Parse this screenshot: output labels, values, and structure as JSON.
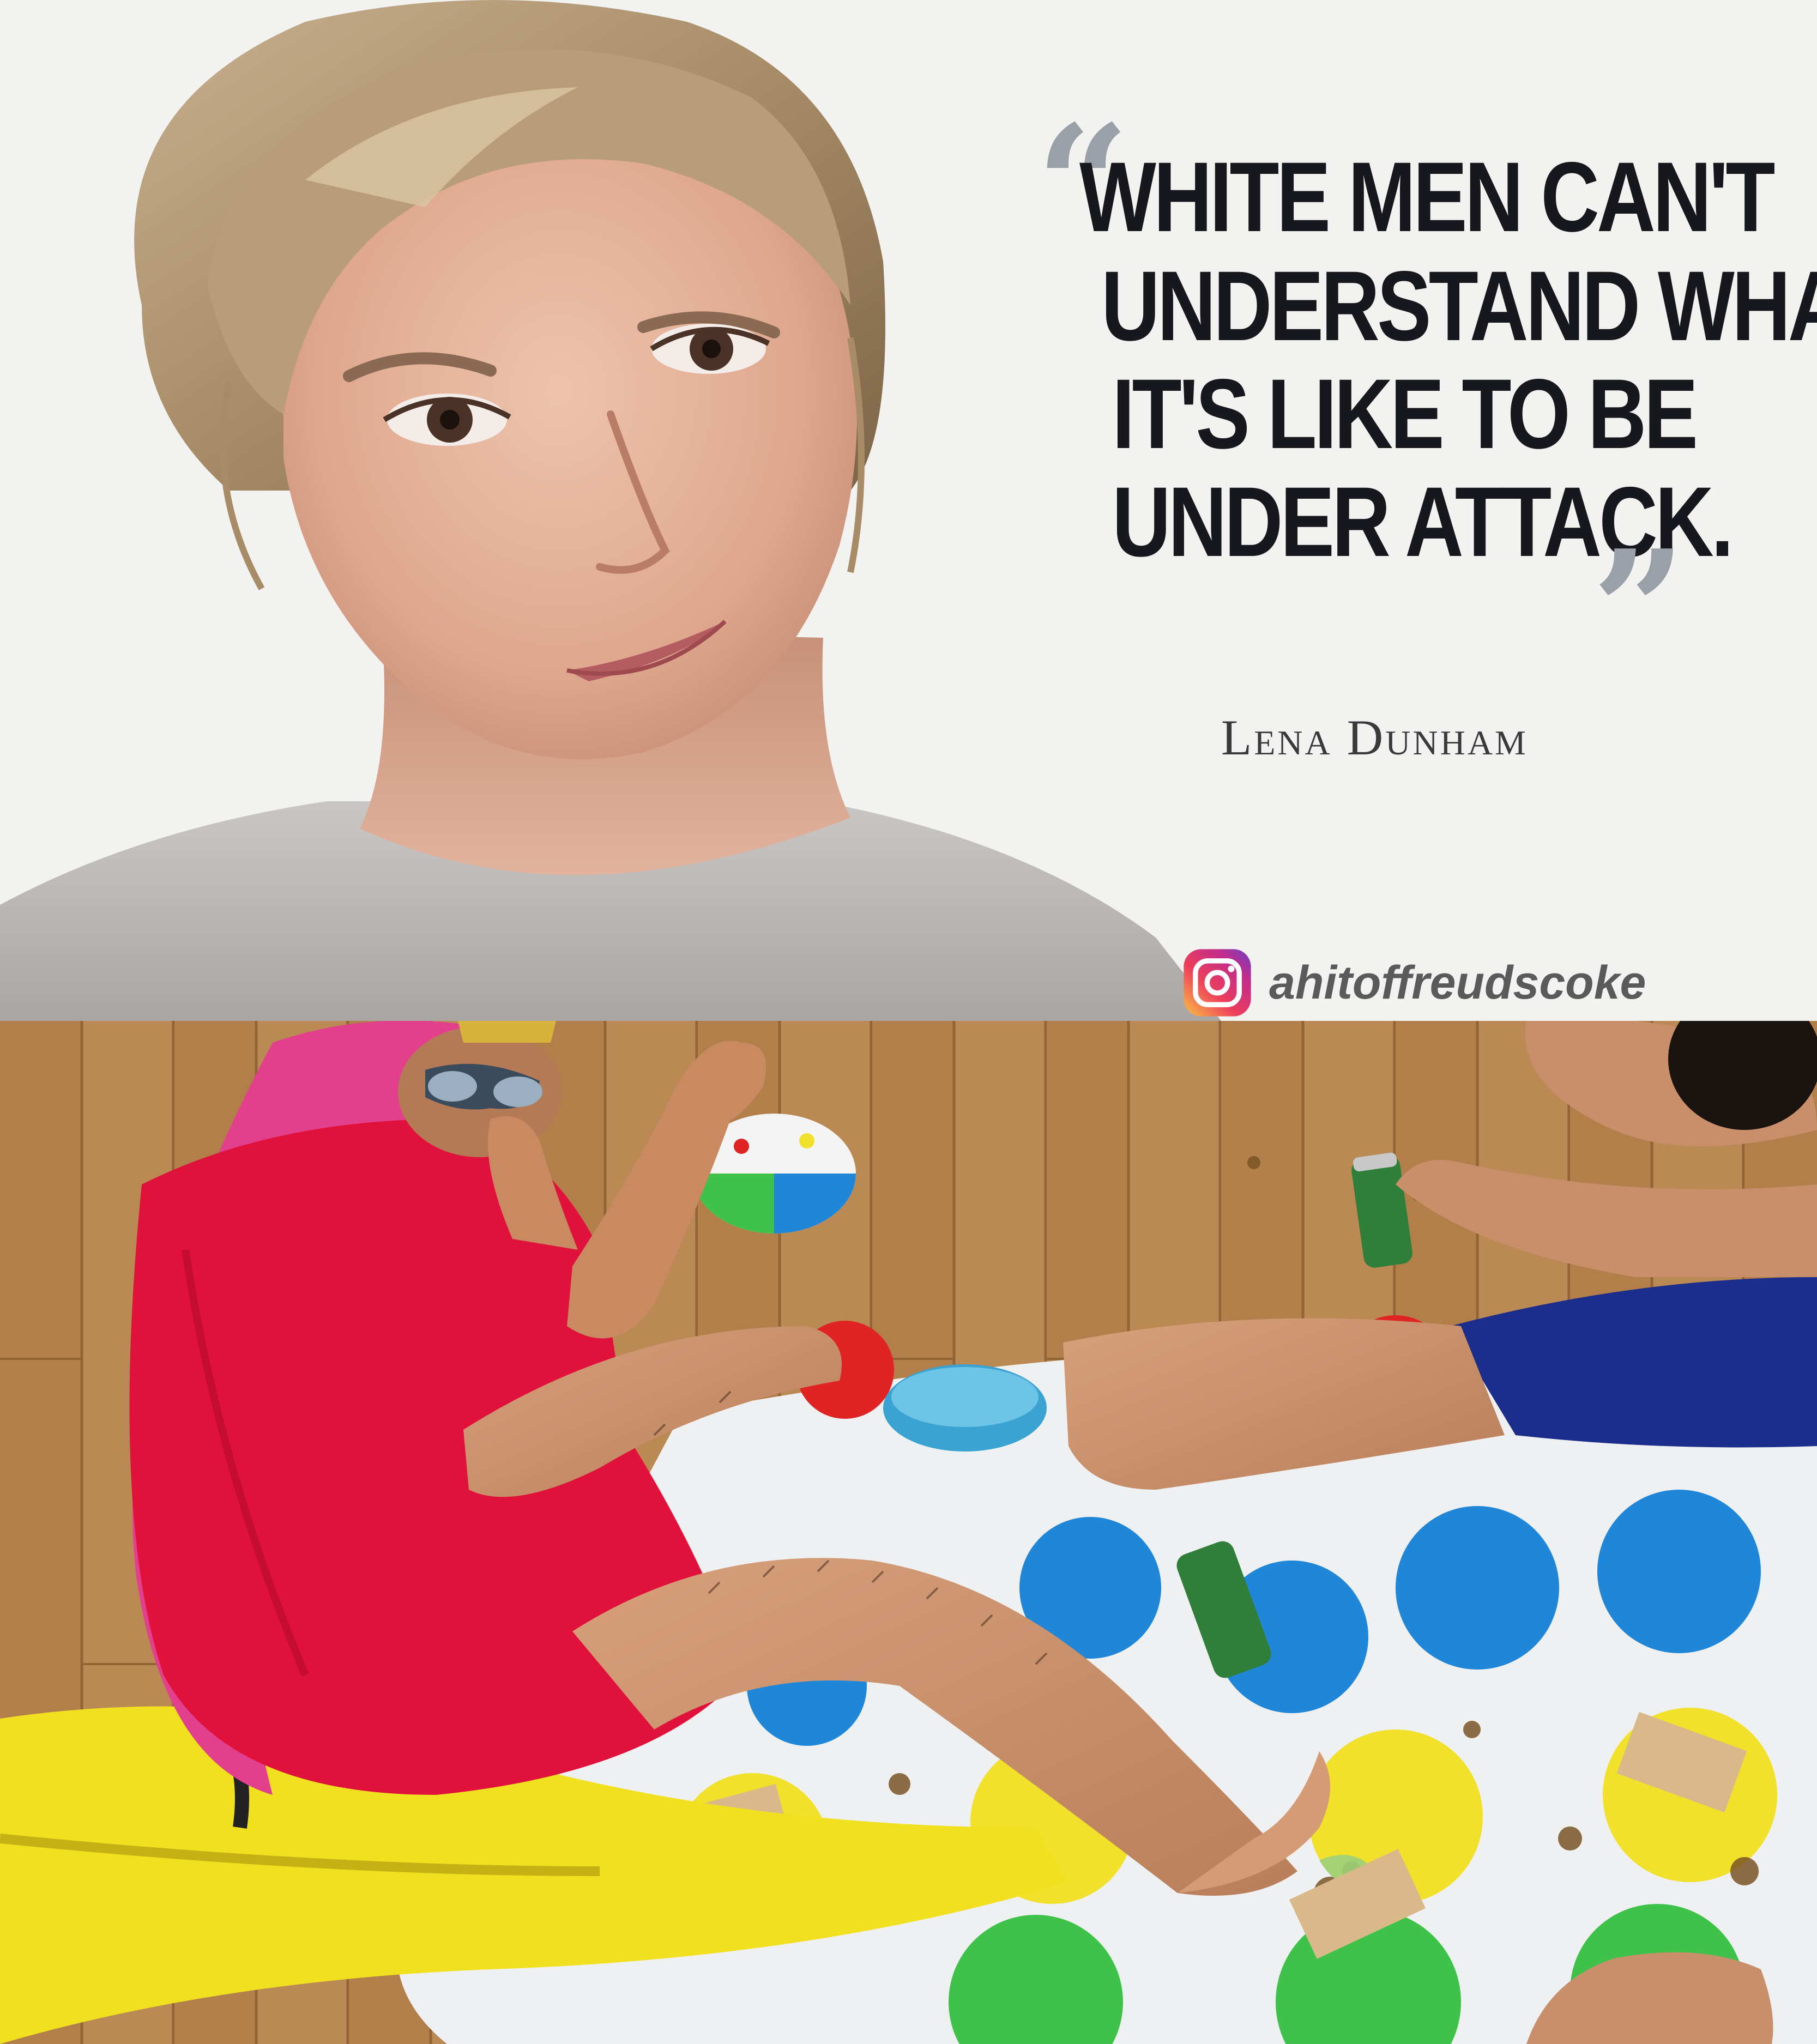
{
  "meme": {
    "quote_open_mark": "“",
    "quote_close_mark": "”",
    "quote_lines": [
      "WHITE MEN CAN'T",
      "UNDERSTAND WHAT",
      "IT'S LIKE TO BE",
      "UNDER ATTACK."
    ],
    "attribution": "Lena Dunham",
    "instagram_handle": "ahitoffreudscoke"
  },
  "colors": {
    "quote_text": "#16181d",
    "quote_marks": "#9aa0a8",
    "top_background": "#f2f2f1",
    "floor": "#b98a55",
    "red_dress": "#e0113a",
    "yellow_suit": "#f0e020"
  },
  "icons": {
    "watermark": "instagram-icon"
  }
}
